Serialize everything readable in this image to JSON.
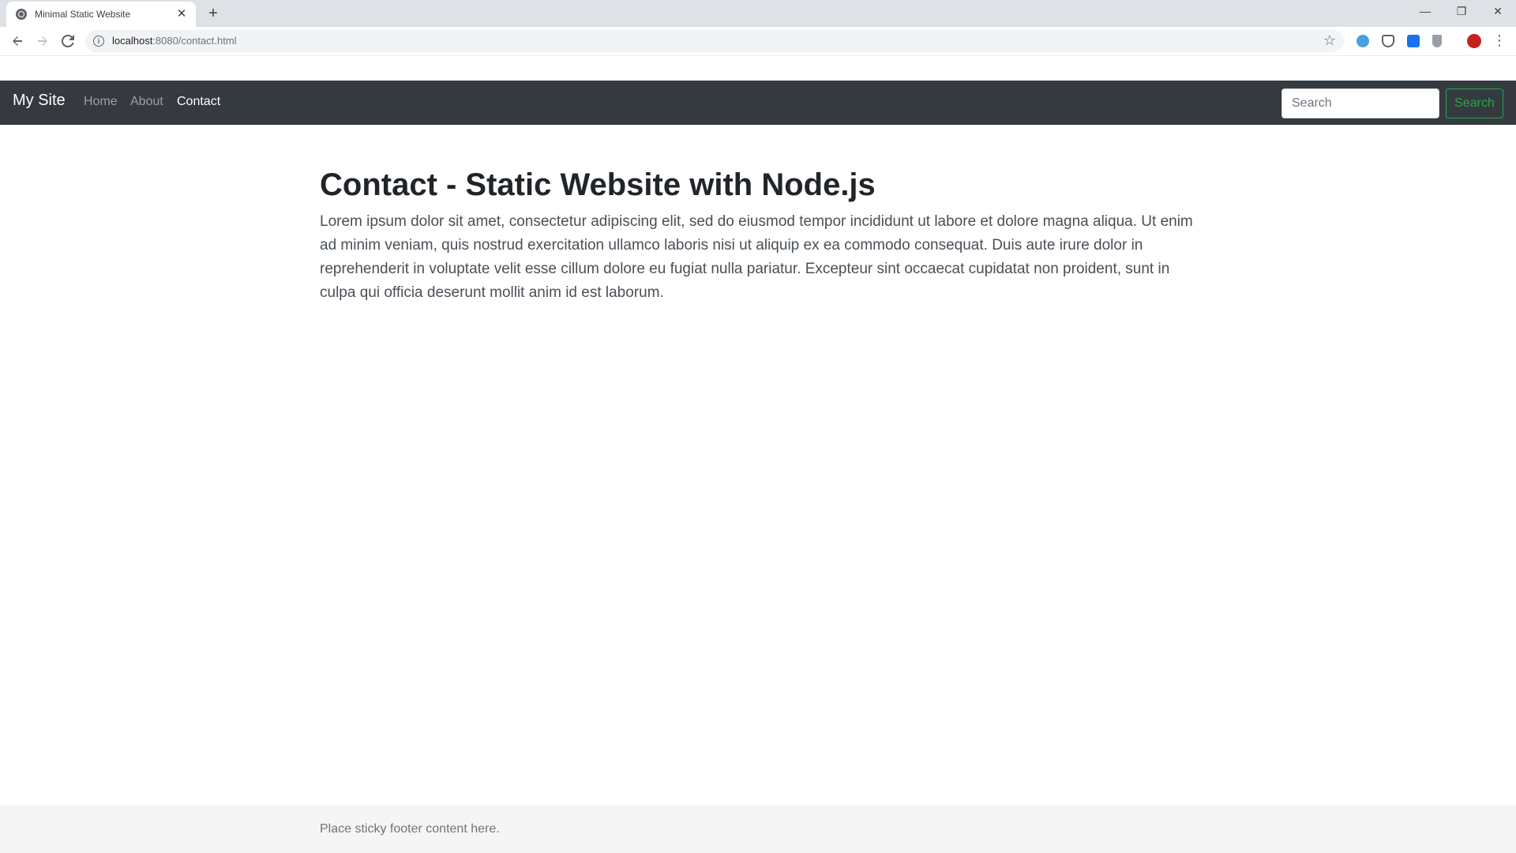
{
  "browser": {
    "tab_title": "Minimal Static Website",
    "tab_close": "✕",
    "new_tab": "+",
    "url_host": "localhost",
    "url_rest": ":8080/contact.html",
    "window_controls": {
      "minimize": "—",
      "restore": "❐",
      "close": "✕"
    },
    "icons": [
      "back-arrow-icon",
      "forward-arrow-icon",
      "reload-icon",
      "site-info-icon",
      "bookmark-star-icon"
    ],
    "extensions": [
      {
        "name": "ext-blue-bird-icon",
        "color": "#4a9fe0"
      },
      {
        "name": "pocket-icon",
        "color": "#5f6368"
      },
      {
        "name": "ext-m-icon",
        "color": "#1a73e8"
      },
      {
        "name": "ext-download-icon",
        "color": "#9aa0a6"
      },
      {
        "name": "profile-avatar-icon",
        "color": "#c5221f"
      }
    ]
  },
  "navbar": {
    "brand": "My Site",
    "links": [
      {
        "label": "Home",
        "active": false
      },
      {
        "label": "About",
        "active": false
      },
      {
        "label": "Contact",
        "active": true
      }
    ],
    "search_placeholder": "Search",
    "search_button": "Search",
    "background": "#343a40",
    "accent": "#28a745"
  },
  "main": {
    "title": "Contact - Static Website with Node.js",
    "body": "Lorem ipsum dolor sit amet, consectetur adipiscing elit, sed do eiusmod tempor incididunt ut labore et dolore magna aliqua. Ut enim ad minim veniam, quis nostrud exercitation ullamco laboris nisi ut aliquip ex ea commodo consequat. Duis aute irure dolor in reprehenderit in voluptate velit esse cillum dolore eu fugiat nulla pariatur. Excepteur sint occaecat cupidatat non proident, sunt in culpa qui officia deserunt mollit anim id est laborum."
  },
  "footer": {
    "text": "Place sticky footer content here."
  }
}
